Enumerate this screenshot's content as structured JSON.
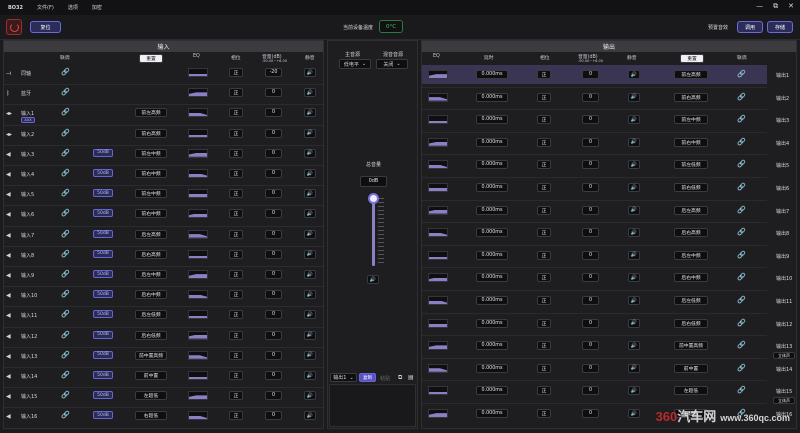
{
  "titlebar": {
    "app": "BO32",
    "menus": [
      "文件(F)",
      "选项",
      "加密"
    ],
    "win": [
      "—",
      "⧉",
      "✕"
    ]
  },
  "toolbar": {
    "reset": "复位",
    "temp_label": "当前设备温度",
    "temp": "0°C",
    "preset_label": "预置音效",
    "apply": "调用",
    "save": "存储"
  },
  "input": {
    "title": "输入",
    "headers": {
      "link": "联调",
      "reset": "重置",
      "eq": "EQ",
      "phase": "相位",
      "gain": "音量(dB)",
      "gain_sub": "-90.00~+6.00",
      "mute": "静音"
    },
    "rows": [
      {
        "label": "同轴",
        "vol": "-20",
        "phase": "正",
        "type": "coax"
      },
      {
        "label": "蓝牙",
        "vol": "0",
        "phase": "正",
        "type": "bt"
      },
      {
        "label": "输入1",
        "vol": "0",
        "phase": "正",
        "type": "aux",
        "pos": "前左高频",
        "badge": "AUX"
      },
      {
        "label": "输入2",
        "vol": "0",
        "phase": "正",
        "type": "aux",
        "pos": "前右高频"
      },
      {
        "label": "输入3",
        "vol": "0",
        "phase": "正",
        "type": "spk",
        "pos": "前左中频",
        "badge": "50dB"
      },
      {
        "label": "输入4",
        "vol": "0",
        "phase": "正",
        "type": "spk",
        "pos": "前右中频",
        "badge": "50dB"
      },
      {
        "label": "输入5",
        "vol": "0",
        "phase": "正",
        "type": "spk",
        "pos": "前左中频",
        "badge": "50dB"
      },
      {
        "label": "输入6",
        "vol": "0",
        "phase": "正",
        "type": "spk",
        "pos": "前右中频",
        "badge": "50dB"
      },
      {
        "label": "输入7",
        "vol": "0",
        "phase": "正",
        "type": "spk",
        "pos": "后左高频",
        "badge": "50dB"
      },
      {
        "label": "输入8",
        "vol": "0",
        "phase": "正",
        "type": "spk",
        "pos": "后右高频",
        "badge": "50dB"
      },
      {
        "label": "输入9",
        "vol": "0",
        "phase": "正",
        "type": "spk",
        "pos": "后左中频",
        "badge": "50dB"
      },
      {
        "label": "输入10",
        "vol": "0",
        "phase": "正",
        "type": "spk",
        "pos": "后右中频",
        "badge": "50dB"
      },
      {
        "label": "输入11",
        "vol": "0",
        "phase": "正",
        "type": "spk",
        "pos": "后左低频",
        "badge": "50dB"
      },
      {
        "label": "输入12",
        "vol": "0",
        "phase": "正",
        "type": "spk",
        "pos": "后右低频",
        "badge": "50dB"
      },
      {
        "label": "输入13",
        "vol": "0",
        "phase": "正",
        "type": "spk",
        "pos": "前中置高频",
        "badge": "50dB"
      },
      {
        "label": "输入14",
        "vol": "0",
        "phase": "正",
        "type": "spk",
        "pos": "前中置",
        "badge": "50dB"
      },
      {
        "label": "输入15",
        "vol": "0",
        "phase": "正",
        "type": "spk",
        "pos": "左超低",
        "badge": "50dB"
      },
      {
        "label": "输入16",
        "vol": "0",
        "phase": "正",
        "type": "spk",
        "pos": "右超低",
        "badge": "50dB"
      }
    ]
  },
  "middle": {
    "master_label": "主音源",
    "master": "低电平",
    "sub_label": "混音音源",
    "sub": "关闭",
    "total_label": "总音量",
    "total": "0dB",
    "output_select": "输出1",
    "copy": "复制",
    "paste": "粘贴"
  },
  "output": {
    "title": "输出",
    "headers": {
      "eq": "EQ",
      "delay": "延时",
      "phase": "相位",
      "gain": "音量(dB)",
      "gain_sub": "-90.00~+6.00",
      "mute": "静音",
      "reset": "重置",
      "link": "联调"
    },
    "rows": [
      {
        "label": "输出1",
        "delay": "0.000ms",
        "phase": "正",
        "vol": "0",
        "pos": "前左高频",
        "hl": true
      },
      {
        "label": "输出2",
        "delay": "0.000ms",
        "phase": "正",
        "vol": "0",
        "pos": "前右高频"
      },
      {
        "label": "输出3",
        "delay": "0.000ms",
        "phase": "正",
        "vol": "0",
        "pos": "前左中频"
      },
      {
        "label": "输出4",
        "delay": "0.000ms",
        "phase": "正",
        "vol": "0",
        "pos": "前右中频"
      },
      {
        "label": "输出5",
        "delay": "0.000ms",
        "phase": "正",
        "vol": "0",
        "pos": "前左低频"
      },
      {
        "label": "输出6",
        "delay": "0.000ms",
        "phase": "正",
        "vol": "0",
        "pos": "前右低频"
      },
      {
        "label": "输出7",
        "delay": "0.000ms",
        "phase": "正",
        "vol": "0",
        "pos": "后左高频"
      },
      {
        "label": "输出8",
        "delay": "0.000ms",
        "phase": "正",
        "vol": "0",
        "pos": "后右高频"
      },
      {
        "label": "输出9",
        "delay": "0.000ms",
        "phase": "正",
        "vol": "0",
        "pos": "后左中频"
      },
      {
        "label": "输出10",
        "delay": "0.000ms",
        "phase": "正",
        "vol": "0",
        "pos": "后右中频"
      },
      {
        "label": "输出11",
        "delay": "0.000ms",
        "phase": "正",
        "vol": "0",
        "pos": "后左低频"
      },
      {
        "label": "输出12",
        "delay": "0.000ms",
        "phase": "正",
        "vol": "0",
        "pos": "后右低频"
      },
      {
        "label": "输出13",
        "delay": "0.000ms",
        "phase": "正",
        "vol": "0",
        "pos": "前中置高频",
        "tag": "立体声"
      },
      {
        "label": "输出14",
        "delay": "0.000ms",
        "phase": "正",
        "vol": "0",
        "pos": "前中置"
      },
      {
        "label": "输出15",
        "delay": "0.000ms",
        "phase": "正",
        "vol": "0",
        "pos": "左超低",
        "tag": "立体声"
      },
      {
        "label": "输出16",
        "delay": "0.000ms",
        "phase": "正",
        "vol": "0",
        "pos": "右超低"
      }
    ]
  },
  "watermark": {
    "a": "360",
    "b": "汽车网",
    "c": "www.360qc.com"
  }
}
